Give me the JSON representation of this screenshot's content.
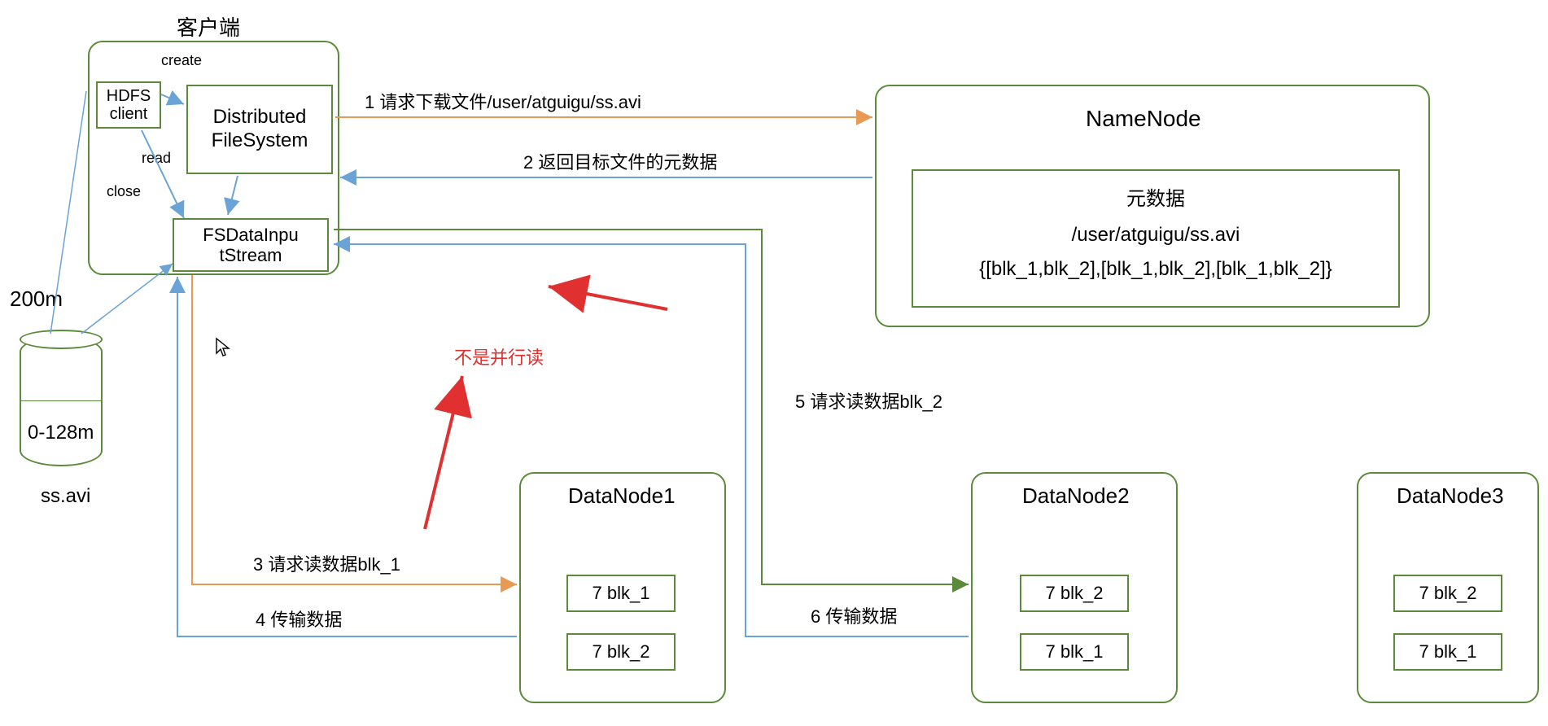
{
  "client": {
    "title": "客户端",
    "hdfs_client": "HDFS\nclient",
    "distributed_fs": "Distributed\nFileSystem",
    "fs_input_stream": "FSDataInpu\ntStream",
    "create": "create",
    "read": "read",
    "close": "close"
  },
  "storage": {
    "size_top": "200m",
    "size_range": "0-128m",
    "filename": "ss.avi"
  },
  "namenode": {
    "title": "NameNode",
    "meta_title": "元数据",
    "meta_path": "/user/atguigu/ss.avi",
    "meta_blocks": "{[blk_1,blk_2],[blk_1,blk_2],[blk_1,blk_2]}"
  },
  "datanodes": [
    {
      "name": "DataNode1",
      "blocks": [
        "7 blk_1",
        "7 blk_2"
      ]
    },
    {
      "name": "DataNode2",
      "blocks": [
        "7 blk_2",
        "7 blk_1"
      ]
    },
    {
      "name": "DataNode3",
      "blocks": [
        "7 blk_2",
        "7 blk_1"
      ]
    }
  ],
  "arrows": {
    "a1": "1 请求下载文件/user/atguigu/ss.avi",
    "a2": "2 返回目标文件的元数据",
    "a3": "3 请求读数据blk_1",
    "a4": "4 传输数据",
    "a5": "5 请求读数据blk_2",
    "a6": "6 传输数据"
  },
  "annotation": {
    "not_parallel": "不是并行读"
  }
}
